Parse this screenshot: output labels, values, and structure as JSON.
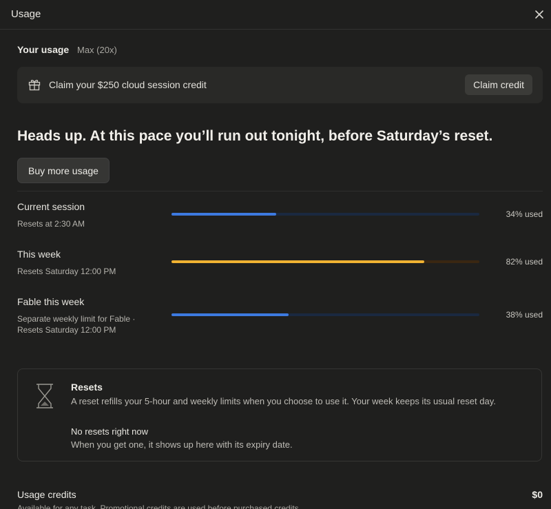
{
  "window": {
    "title": "Usage"
  },
  "your_usage": {
    "label": "Your usage",
    "plan": "Max (20x)"
  },
  "claim_banner": {
    "icon": "gift-icon",
    "text": "Claim your $250 cloud session credit",
    "button_label": "Claim credit"
  },
  "headline": "Heads up. At this pace you’ll run out tonight, before Saturday’s reset.",
  "buy_button_label": "Buy more usage",
  "meters": [
    {
      "label": "Current session",
      "sublabel": "Resets at 2:30 AM",
      "value_text": "34% used",
      "percent": 34,
      "fill_color": "#3d7ae0",
      "track_color": "#1a2940"
    },
    {
      "label": "This week",
      "sublabel": "Resets Saturday 12:00 PM",
      "value_text": "82% used",
      "percent": 82,
      "fill_color": "#f0b232",
      "track_color": "#3a2712"
    },
    {
      "label": "Fable this week",
      "sublabel_line1": "Separate weekly limit for Fable ·",
      "sublabel_line2": "Resets Saturday 12:00 PM",
      "value_text": "38% used",
      "percent": 38,
      "fill_color": "#3d7ae0",
      "track_color": "#1a2940"
    }
  ],
  "resets": {
    "icon": "hourglass-icon",
    "title": "Resets",
    "description": "A reset refills your 5-hour and weekly limits when you choose to use it. Your week keeps its usual reset day.",
    "empty_title": "No resets right now",
    "empty_description": "When you get one, it shows up here with its expiry date."
  },
  "usage_credits": {
    "title": "Usage credits",
    "amount": "$0",
    "description": "Available for any task. Promotional credits are used before purchased credits."
  }
}
